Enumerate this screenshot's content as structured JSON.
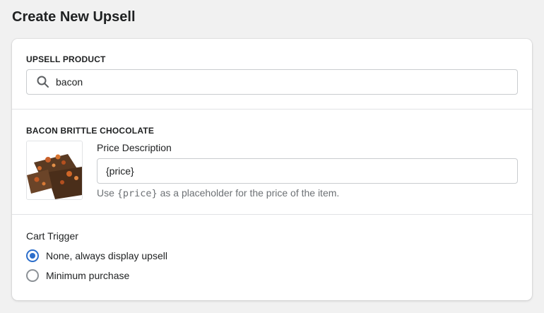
{
  "page": {
    "title": "Create New Upsell"
  },
  "upsell_product": {
    "label": "UPSELL PRODUCT",
    "search_value": "bacon"
  },
  "product": {
    "name": "BACON BRITTLE CHOCOLATE",
    "image_alt": "Bacon brittle chocolate product photo"
  },
  "price_description": {
    "label": "Price Description",
    "value": "{price}",
    "help_prefix": "Use ",
    "help_code": "{price}",
    "help_suffix": " as a placeholder for the price of the item."
  },
  "cart_trigger": {
    "label": "Cart Trigger",
    "options": [
      {
        "label": "None, always display upsell",
        "checked": true
      },
      {
        "label": "Minimum purchase",
        "checked": false
      }
    ]
  },
  "colors": {
    "accent": "#2c6ecb",
    "background": "#f1f1f1",
    "border": "#c9cccf",
    "muted_text": "#6d7175"
  }
}
